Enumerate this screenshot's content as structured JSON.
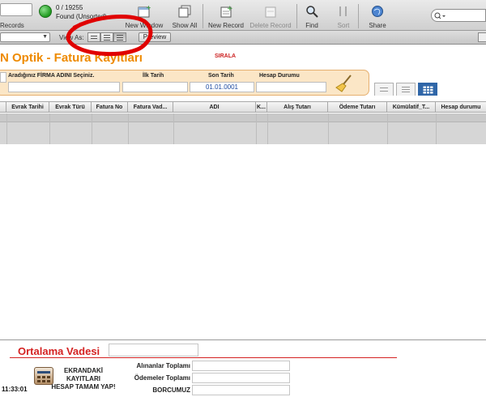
{
  "toolbar": {
    "record_count": "0 / 19255",
    "found_status": "Found (Unsorted)",
    "records_label": "Records",
    "buttons": {
      "new_window": "New Window",
      "show_all": "Show All",
      "new_record": "New Record",
      "delete_record": "Delete Record",
      "find": "Find",
      "sort": "Sort",
      "share": "Share"
    }
  },
  "layout_bar": {
    "layout_value": "",
    "view_as_label": "View As:",
    "preview_label": "Preview"
  },
  "page": {
    "title": "N Optik - Fatura Kayıtları",
    "sort_link": "SIRALA"
  },
  "filters": {
    "company_label": "Aradığınız FİRMA ADINI Seçiniz.",
    "start_date_label": "İlk Tarih",
    "end_date_label": "Son Tarih",
    "end_date_value": "01.01.0001",
    "account_status_label": "Hesap Durumu"
  },
  "table": {
    "columns": [
      "Evrak Tarihi",
      "Evrak Türü",
      "Fatura No",
      "Fatura Vad...",
      "ADI",
      "K...",
      "Alış Tutarı",
      "Ödeme Tutarı",
      "Kümülatif_T...",
      "Hesap durumu"
    ]
  },
  "footer": {
    "average_due_label": "Ortalama Vadesi",
    "screen_calc_label": [
      "EKRANDAKİ",
      "KAYITLARI",
      "HESAP TAMAM YAP!"
    ],
    "purchases_total_label": "Alınanlar Toplamı",
    "payments_total_label": "Ödemeler Toplamı",
    "debt_label": "BORCUMUZ",
    "time": "11:33:01"
  },
  "colors": {
    "title_orange": "#ee8a00",
    "accent_red": "#d42222",
    "filter_panel": "#fbe6c6",
    "annotation_red": "#e00000"
  },
  "icons": [
    "status-green-dot",
    "new-window-icon",
    "show-all-icon",
    "new-record-icon",
    "delete-record-icon",
    "find-icon",
    "sort-icon",
    "share-icon",
    "search-icon",
    "broom-icon",
    "calculator-icon"
  ]
}
